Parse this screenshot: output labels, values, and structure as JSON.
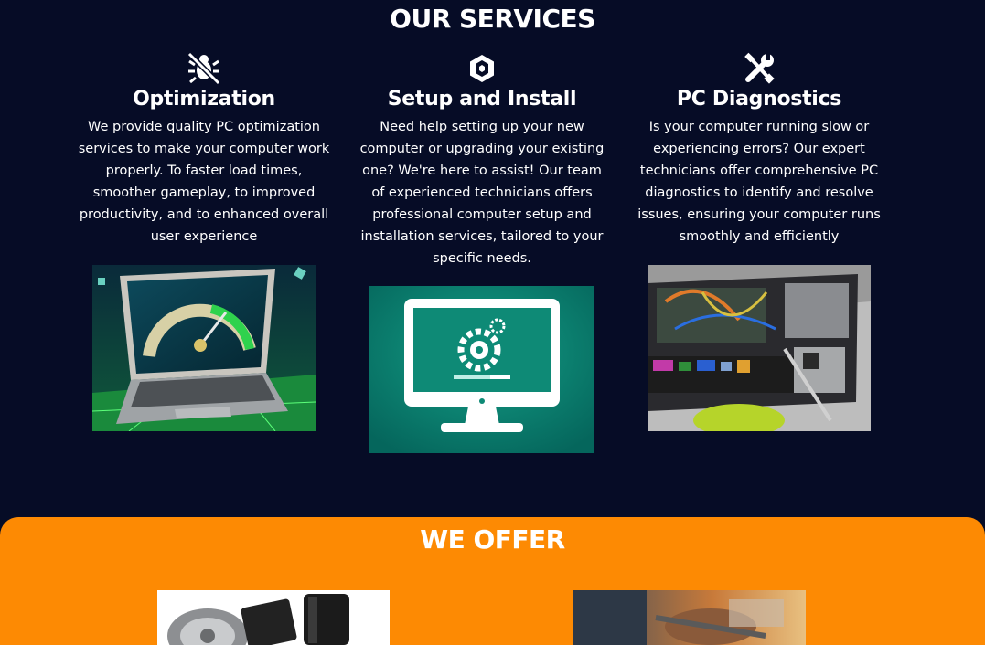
{
  "services": {
    "title": "OUR SERVICES",
    "items": [
      {
        "icon": "bug-slash-icon",
        "title": "Optimization",
        "desc": "We provide quality PC optimization services to make your computer work properly. To faster load times, smoother gameplay, to improved productivity, and to enhanced overall user experience"
      },
      {
        "icon": "cube-icon",
        "title": "Setup and Install",
        "desc": "Need help setting up your new computer or upgrading your existing one? We're here to assist! Our team of experienced technicians offers professional computer setup and installation services, tailored to your specific needs."
      },
      {
        "icon": "screwdriver-wrench-icon",
        "title": "PC Diagnostics",
        "desc": "Is your computer running slow or experiencing errors? Our expert technicians offer comprehensive PC diagnostics to identify and resolve issues, ensuring your computer runs smoothly and efficiently"
      }
    ]
  },
  "offer": {
    "title": "WE OFFER"
  },
  "colors": {
    "background": "#060c26",
    "offer_background": "#fd8a03",
    "text": "#ffffff"
  }
}
